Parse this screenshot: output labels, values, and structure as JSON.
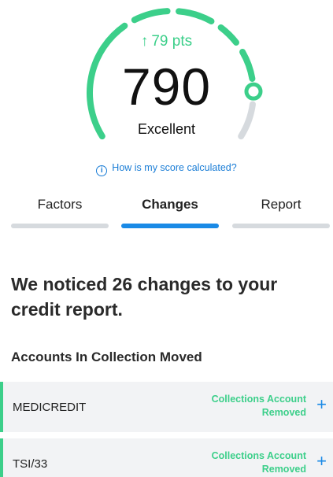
{
  "gauge": {
    "delta_label": "79 pts",
    "score": "790",
    "rating": "Excellent",
    "accent_color": "#3ccf8a",
    "track_color": "#d6dade"
  },
  "help_link": "How is my score calculated?",
  "tabs": [
    {
      "label": "Factors",
      "active": false
    },
    {
      "label": "Changes",
      "active": true
    },
    {
      "label": "Report",
      "active": false
    }
  ],
  "headline": "We noticed 26 changes to your credit report.",
  "section": {
    "title": "Accounts In Collection Moved",
    "rows": [
      {
        "name": "MEDICREDIT",
        "status_line1": "Collections Account",
        "status_line2": "Removed"
      },
      {
        "name": "TSI/33",
        "status_line1": "Collections Account",
        "status_line2": "Removed"
      }
    ]
  },
  "icons": {
    "delta": "arrow-up-icon",
    "help": "info-icon",
    "expand": "plus-icon"
  },
  "colors": {
    "tab_active": "#1a8ae6",
    "link": "#1a7dd6",
    "row_bg": "#f2f3f5"
  }
}
